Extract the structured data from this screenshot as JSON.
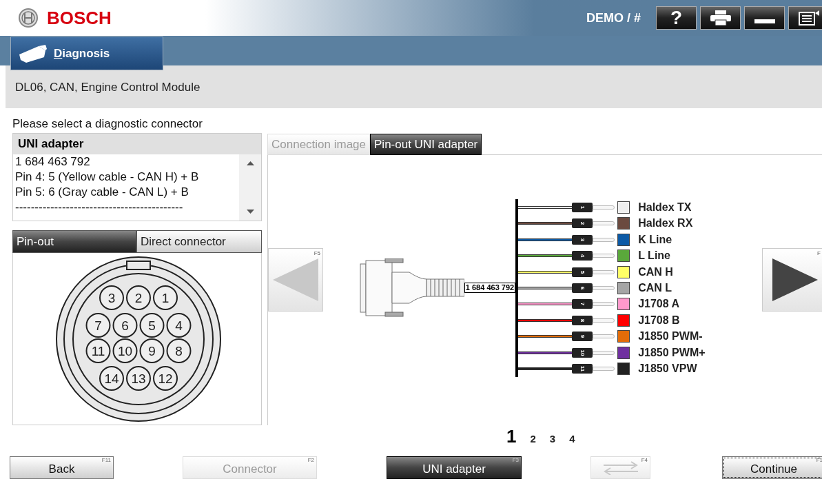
{
  "header": {
    "brand": "BOSCH",
    "user": "DEMO / #",
    "buttons": [
      {
        "kind": "help",
        "label": "?"
      },
      {
        "kind": "print"
      },
      {
        "kind": "minimize"
      },
      {
        "kind": "menu"
      }
    ]
  },
  "nav_tabs": [
    {
      "label": "Diagnosis",
      "selected": true
    }
  ],
  "breadcrumb": "DL06, CAN, Engine Control Module",
  "prompt": "Please select a diagnostic connector",
  "adapter_list": {
    "header": "UNI adapter",
    "lines": [
      "1 684 463 792",
      "Pin 4: 5 (Yellow cable - CAN H) + B",
      "Pin 5: 6 (Gray cable - CAN L) + B",
      "-------------------------------------------"
    ]
  },
  "left_tabs": [
    {
      "label": "Pin-out",
      "selected": true
    },
    {
      "label": "Direct connector",
      "selected": false
    }
  ],
  "pin_rows": [
    [
      "3",
      "2",
      "1"
    ],
    [
      "7",
      "6",
      "5",
      "4"
    ],
    [
      "11",
      "10",
      "9",
      "8"
    ],
    [
      "14",
      "13",
      "12"
    ]
  ],
  "right_tabs": [
    {
      "label": "Connection image",
      "selected": false,
      "disabled": true
    },
    {
      "label": "Pin-out UNI adapter",
      "selected": true,
      "disabled": false
    }
  ],
  "prev_button": {
    "key": "F5"
  },
  "next_button": {
    "key": "F"
  },
  "cable_label": "1 684 463 792",
  "wires": [
    {
      "pin": "1",
      "label": "Haldex TX",
      "color": "#efefef"
    },
    {
      "pin": "2",
      "label": "Haldex RX",
      "color": "#6b4a3f"
    },
    {
      "pin": "3",
      "label": "K Line",
      "color": "#0c5aa6"
    },
    {
      "pin": "4",
      "label": "L Line",
      "color": "#5aa83b"
    },
    {
      "pin": "5",
      "label": "CAN H",
      "color": "#ffff66"
    },
    {
      "pin": "6",
      "label": "CAN L",
      "color": "#a5a5a5"
    },
    {
      "pin": "7",
      "label": "J1708 A",
      "color": "#ff99cc"
    },
    {
      "pin": "8",
      "label": "J1708 B",
      "color": "#ff0000"
    },
    {
      "pin": "9",
      "label": "J1850 PWM-",
      "color": "#e36c09"
    },
    {
      "pin": "10",
      "label": "J1850 PWM+",
      "color": "#7030a0"
    },
    {
      "pin": "11",
      "label": "J1850 VPW",
      "color": "#222222"
    }
  ],
  "pages": [
    {
      "label": "1",
      "selected": true
    },
    {
      "label": "2",
      "selected": false
    },
    {
      "label": "3",
      "selected": false
    },
    {
      "label": "4",
      "selected": false
    }
  ],
  "footer_buttons": [
    {
      "kind": "text",
      "label": "Back",
      "key": "F11",
      "disabled": false,
      "selected": false,
      "focused": false
    },
    {
      "kind": "text",
      "label": "Connector",
      "key": "F2",
      "disabled": true,
      "selected": false,
      "focused": false
    },
    {
      "kind": "text",
      "label": "UNI adapter",
      "key": "F3",
      "disabled": false,
      "selected": true,
      "focused": false
    },
    {
      "kind": "swap",
      "key": "F4",
      "disabled": true,
      "selected": false,
      "focused": false
    },
    {
      "kind": "text",
      "label": "Continue",
      "key": "F1",
      "disabled": false,
      "selected": false,
      "focused": true
    }
  ]
}
